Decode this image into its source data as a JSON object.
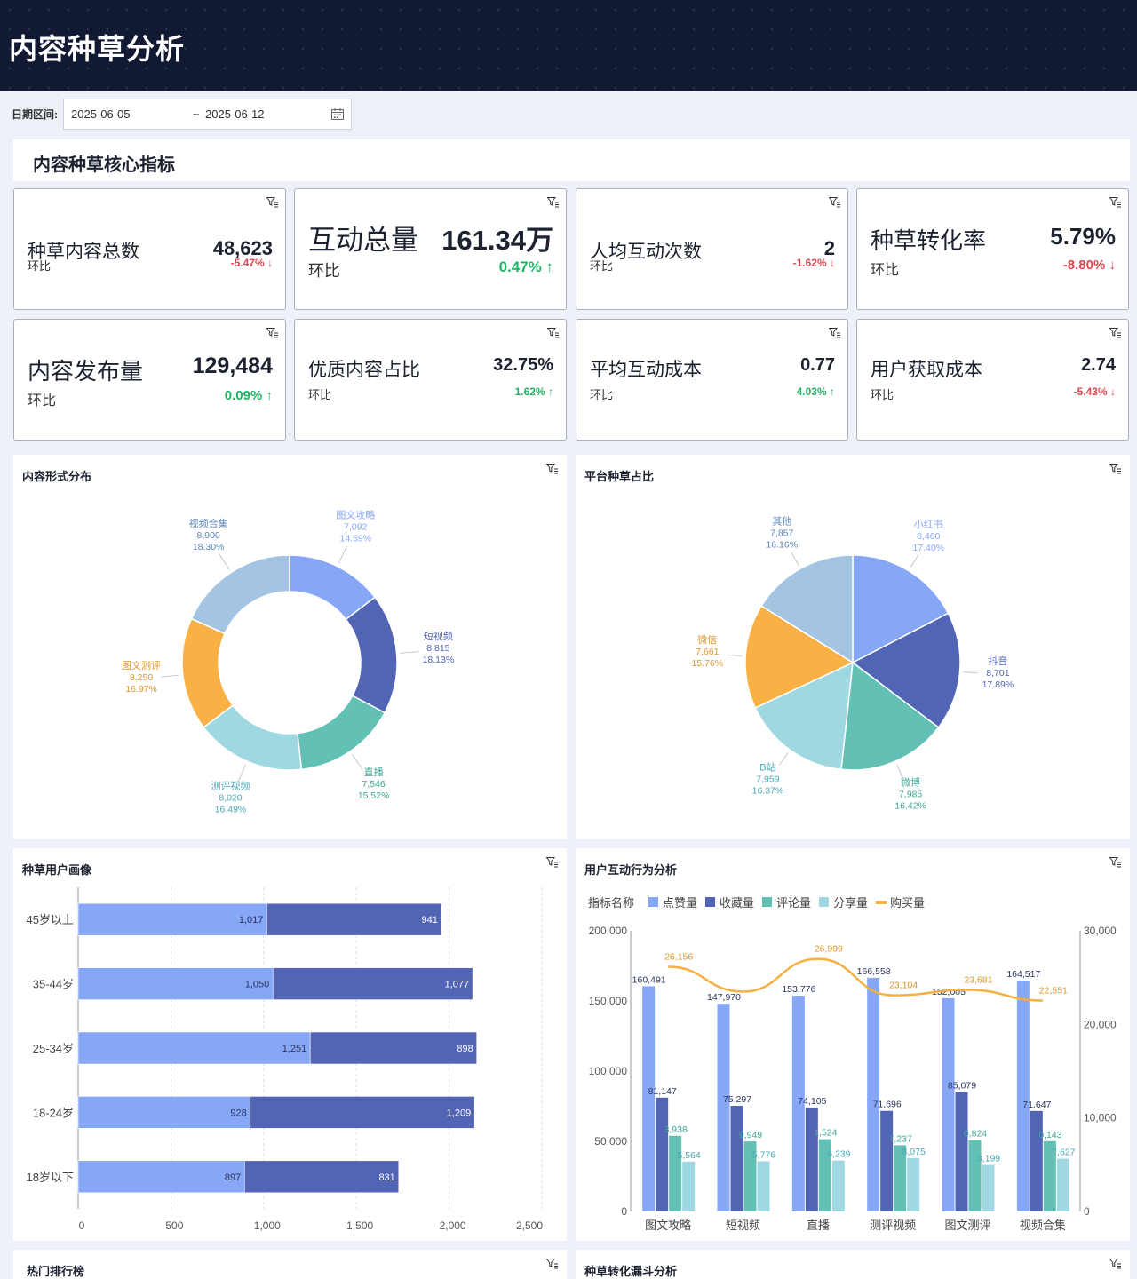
{
  "header": {
    "title": "内容种草分析"
  },
  "datebar": {
    "label": "日期区间:",
    "start": "2025-06-05",
    "sep": "~",
    "end": "2025-06-12"
  },
  "core": {
    "title": "内容种草核心指标"
  },
  "kpis": [
    {
      "name": "种草内容总数",
      "value": "48,623",
      "hb": "环比",
      "change": "-5.47%",
      "dir": "down"
    },
    {
      "name": "互动总量",
      "value": "161.34万",
      "hb": "环比",
      "change": "0.47%",
      "dir": "up"
    },
    {
      "name": "人均互动次数",
      "value": "2",
      "hb": "环比",
      "change": "-1.62%",
      "dir": "down"
    },
    {
      "name": "种草转化率",
      "value": "5.79%",
      "hb": "环比",
      "change": "-8.80%",
      "dir": "down"
    },
    {
      "name": "内容发布量",
      "value": "129,484",
      "hb": "环比",
      "change": "0.09%",
      "dir": "up"
    },
    {
      "name": "优质内容占比",
      "value": "32.75%",
      "hb": "环比",
      "change": "1.62%",
      "dir": "up"
    },
    {
      "name": "平均互动成本",
      "value": "0.77",
      "hb": "环比",
      "change": "4.03%",
      "dir": "up"
    },
    {
      "name": "用户获取成本",
      "value": "2.74",
      "hb": "环比",
      "change": "-5.43%",
      "dir": "down"
    }
  ],
  "colors": {
    "c1": "#86a6f6",
    "c2": "#5265b4",
    "c3": "#62c1b4",
    "c4": "#9fd8e0",
    "c5": "#f9b044",
    "c6": "#a3c5e3",
    "line": "#f5b041"
  },
  "panels": {
    "format": {
      "title": "内容形式分布"
    },
    "platform": {
      "title": "平台种草占比"
    },
    "users": {
      "title": "种草用户画像"
    },
    "behavior": {
      "title": "用户互动行为分析"
    },
    "ranking": {
      "title": "热门排行榜"
    },
    "funnel": {
      "title": "种草转化漏斗分析"
    }
  },
  "chart_data": [
    {
      "type": "pie",
      "variant": "donut",
      "title": "内容形式分布",
      "slices": [
        {
          "name": "图文攻略",
          "value": 7092,
          "pct": "14.59%",
          "color": "#86a6f6"
        },
        {
          "name": "短视频",
          "value": 8815,
          "pct": "18.13%",
          "color": "#5265b4"
        },
        {
          "name": "直播",
          "value": 7546,
          "pct": "15.52%",
          "color": "#62c1b4"
        },
        {
          "name": "测评视频",
          "value": 8020,
          "pct": "16.49%",
          "color": "#9fd8e0"
        },
        {
          "name": "图文测评",
          "value": 8250,
          "pct": "16.97%",
          "color": "#f9b044"
        },
        {
          "name": "视频合集",
          "value": 8900,
          "pct": "18.30%",
          "color": "#a3c5e3"
        }
      ]
    },
    {
      "type": "pie",
      "title": "平台种草占比",
      "slices": [
        {
          "name": "小红书",
          "value": 8460,
          "pct": "17.40%",
          "color": "#86a6f6"
        },
        {
          "name": "抖音",
          "value": 8701,
          "pct": "17.89%",
          "color": "#5265b4"
        },
        {
          "name": "微博",
          "value": 7985,
          "pct": "16.42%",
          "color": "#62c1b4"
        },
        {
          "name": "B站",
          "value": 7959,
          "pct": "16.37%",
          "color": "#9fd8e0"
        },
        {
          "name": "微信",
          "value": 7661,
          "pct": "15.76%",
          "color": "#f9b044"
        },
        {
          "name": "其他",
          "value": 7857,
          "pct": "16.16%",
          "color": "#a3c5e3"
        }
      ]
    },
    {
      "type": "bar",
      "orientation": "horizontal-stacked",
      "title": "种草用户画像",
      "categories": [
        "45岁以上",
        "35-44岁",
        "25-34岁",
        "18-24岁",
        "18岁以下"
      ],
      "series": [
        {
          "values": [
            1017,
            1050,
            1251,
            928,
            897
          ]
        },
        {
          "values": [
            941,
            1077,
            898,
            1209,
            831
          ]
        }
      ],
      "xlim": [
        0,
        2500
      ],
      "xticks": [
        "0",
        "500",
        "1,000",
        "1,500",
        "2,000",
        "2,500"
      ]
    },
    {
      "type": "bar",
      "variant": "grouped-bar-with-line",
      "title": "用户互动行为分析",
      "legend_label": "指标名称",
      "categories": [
        "图文攻略",
        "短视频",
        "直播",
        "测评视频",
        "图文测评",
        "视频合集"
      ],
      "series": [
        {
          "name": "点赞量",
          "axis": "left",
          "values": [
            160491,
            147970,
            153776,
            166558,
            152005,
            164517
          ]
        },
        {
          "name": "收藏量",
          "axis": "left",
          "values": [
            81147,
            75297,
            74105,
            71696,
            85079,
            71647
          ]
        },
        {
          "name": "评论量",
          "axis": "left",
          "values": [
            53938,
            49949,
            51524,
            47237,
            50824,
            50143
          ]
        },
        {
          "name": "分享量",
          "axis": "left",
          "values": [
            35564,
            35776,
            36239,
            38075,
            33199,
            37627
          ]
        },
        {
          "name": "购买量",
          "axis": "right",
          "type": "line",
          "values": [
            26156,
            23500,
            26999,
            23104,
            23681,
            22551
          ]
        }
      ],
      "labels": {
        "点赞量": [
          "160,491",
          "147,970",
          "153,776",
          "166,558",
          "152,005",
          "164,517"
        ],
        "收藏量": [
          "81,147",
          "75,297",
          "74,105",
          "71,696",
          "85,079",
          "71,647"
        ],
        "评论量": [
          "3,938",
          "9,949",
          "1,524",
          "7,237",
          "0,824",
          "0,143"
        ],
        "分享量": [
          "5,564",
          "5,776",
          "6,239",
          "8,075",
          "3,199",
          "7,627"
        ],
        "购买量": [
          "26,156",
          "",
          "26,999",
          "23,104",
          "23,681",
          "22,551"
        ]
      },
      "ylim": [
        0,
        200000
      ],
      "y2lim": [
        0,
        30000
      ],
      "yticks": [
        "200,000",
        "150,000",
        "100,000",
        "50,000",
        "0"
      ],
      "y2ticks": [
        "30,000",
        "20,000",
        "10,000",
        "0"
      ]
    }
  ]
}
